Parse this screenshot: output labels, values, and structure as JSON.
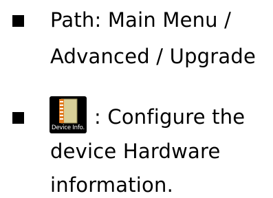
{
  "items": [
    {
      "lines": [
        "Path: Main Menu /",
        "Advanced / Upgrade"
      ]
    },
    {
      "icon": "device-info-notebook-icon",
      "icon_label": "Device Info.",
      "first_line": ": Configure the",
      "lines": [
        "device Hardware",
        "information."
      ]
    }
  ],
  "colors": {
    "text": "#000000",
    "icon_background": "#000000",
    "notebook_cover": "#d9cf98",
    "notebook_spine": "#e07a20"
  }
}
